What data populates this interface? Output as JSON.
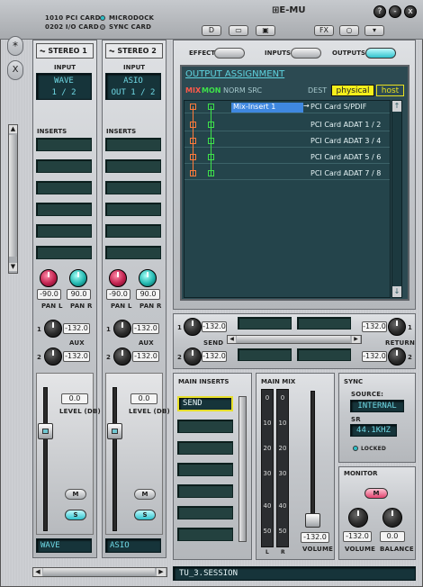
{
  "header": {
    "card_1010": "1010 PCI CARD",
    "card_0202": "0202 I/O CARD",
    "microdock": "MICRODOCK",
    "sync_card": "SYNC CARD",
    "logo": "E-MU",
    "help": "?",
    "minimize": "-",
    "close": "x"
  },
  "toolbar": {
    "new_label": "D",
    "fx_label": "FX"
  },
  "side_tabs": [
    "*",
    "X"
  ],
  "strips": [
    {
      "name": "STEREO",
      "number": "1",
      "input_header": "INPUT",
      "input_line1": "WAVE",
      "input_line2": "1 / 2",
      "inserts_header": "INSERTS",
      "pan_l": "-90.0",
      "pan_r": "90.0",
      "pan_l_label": "PAN L",
      "pan_r_label": "PAN R",
      "aux_1_value": "-132.0",
      "aux_2_value": "-132.0",
      "aux_label": "AUX",
      "aux_1_num": "1",
      "aux_2_num": "2",
      "level": "0.0",
      "level_label": "LEVEL (DB)",
      "mute": "M",
      "solo": "S",
      "name_lcd": "WAVE"
    },
    {
      "name": "STEREO",
      "number": "2",
      "input_header": "INPUT",
      "input_line1": "ASIO",
      "input_line2": "OUT 1 / 2",
      "inserts_header": "INSERTS",
      "pan_l": "-90.0",
      "pan_r": "90.0",
      "pan_l_label": "PAN L",
      "pan_r_label": "PAN R",
      "aux_1_value": "-132.0",
      "aux_2_value": "-132.0",
      "aux_label": "AUX",
      "aux_1_num": "1",
      "aux_2_num": "2",
      "level": "0.0",
      "level_label": "LEVEL (DB)",
      "mute": "M",
      "solo": "S",
      "name_lcd": "ASIO"
    }
  ],
  "view_tabs": {
    "effect": "EFFECT",
    "inputs": "INPUTS",
    "outputs": "OUTPUTS"
  },
  "output_assignment": {
    "title": "OUTPUT ASSIGNMENT",
    "mix": "MIX",
    "mon": "MON",
    "norm_src": "NORM SRC",
    "dest": "DEST",
    "physical": "physical",
    "host": "host",
    "rows": [
      {
        "source": "Mix-Insert 1",
        "dest": "PCI Card S/PDIF"
      },
      {
        "source": "",
        "dest": "PCI Card ADAT 1 / 2"
      },
      {
        "source": "",
        "dest": "PCI Card ADAT 3 / 4"
      },
      {
        "source": "",
        "dest": "PCI Card ADAT 5 / 6"
      },
      {
        "source": "",
        "dest": "PCI Card ADAT 7 / 8"
      }
    ],
    "scroll_up": "↑",
    "scroll_down": "↓"
  },
  "sends": {
    "send_1_num": "1",
    "send_2_num": "2",
    "send_1": "-132.0",
    "send_2": "-132.0",
    "send_label": "SEND",
    "return_1_num": "1",
    "return_2_num": "2",
    "return_1": "-132.0",
    "return_2": "-132.0",
    "return_label": "RETURN"
  },
  "main_inserts": {
    "header": "MAIN INSERTS",
    "first": "SEND"
  },
  "main_mix": {
    "header": "MAIN MIX",
    "scale": [
      "0",
      "10",
      "20",
      "30",
      "40",
      "50"
    ],
    "l": "L",
    "r": "R",
    "volume": "-132.0",
    "volume_label": "VOLUME"
  },
  "sync": {
    "header": "SYNC",
    "source_label": "SOURCE:",
    "source": "INTERNAL",
    "sr_label": "SR",
    "sr": "44.1KHZ",
    "locked": "LOCKED"
  },
  "monitor": {
    "header": "MONITOR",
    "mute": "M",
    "volume": "-132.0",
    "balance": "0.0",
    "volume_label": "VOLUME",
    "balance_label": "BALANCE"
  },
  "session": "TU_3.SESSION"
}
